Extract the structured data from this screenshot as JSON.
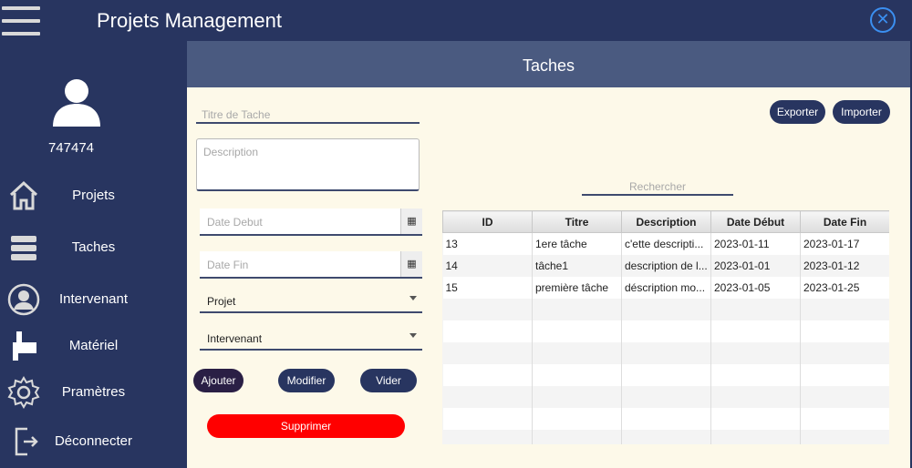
{
  "app": {
    "title": "Projets Management"
  },
  "user": {
    "id": "747474"
  },
  "nav": [
    {
      "label": "Projets",
      "icon": "home-icon"
    },
    {
      "label": "Taches",
      "icon": "stack-icon"
    },
    {
      "label": "Intervenant",
      "icon": "user-icon"
    },
    {
      "label": "Matériel",
      "icon": "tool-icon"
    },
    {
      "label": "Pramètres",
      "icon": "gear-icon"
    },
    {
      "label": "Déconnecter",
      "icon": "logout-icon"
    }
  ],
  "page": {
    "title": "Taches"
  },
  "form": {
    "titre_placeholder": "Titre de Tache",
    "description_placeholder": "Description",
    "date_debut_placeholder": "Date Debut",
    "date_fin_placeholder": "Date Fin",
    "projet_value": "Projet",
    "intervenant_value": "Intervenant"
  },
  "buttons": {
    "ajouter": "Ajouter",
    "modifier": "Modifier",
    "vider": "Vider",
    "supprimer": "Supprimer",
    "exporter": "Exporter",
    "importer": "Importer"
  },
  "search": {
    "placeholder": "Rechercher"
  },
  "table": {
    "columns": [
      "ID",
      "Titre",
      "Description",
      "Date Début",
      "Date Fin"
    ],
    "rows": [
      [
        "13",
        "1ere tâche",
        "c'ette descripti...",
        "2023-01-11",
        "2023-01-17"
      ],
      [
        "14",
        "tâche1",
        "description de l...",
        "2023-01-01",
        "2023-01-12"
      ],
      [
        "15",
        "première tâche",
        "déscription mo...",
        "2023-01-05",
        "2023-01-25"
      ]
    ]
  },
  "colors": {
    "sidebar": "#283560",
    "content": "#fdf9e9",
    "header": "#4a5a80",
    "danger": "#ff0000",
    "accent": "#3b8ff0"
  }
}
